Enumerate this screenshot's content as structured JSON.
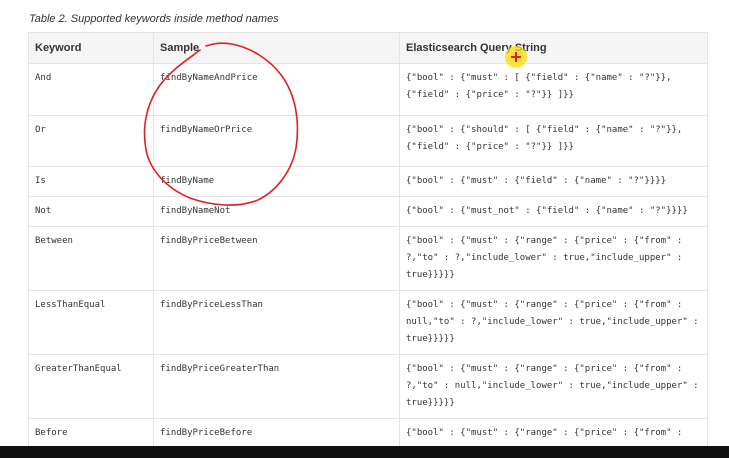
{
  "caption": "Table 2. Supported keywords inside method names",
  "table": {
    "headers": [
      "Keyword",
      "Sample",
      "Elasticsearch Query String"
    ],
    "rows": [
      {
        "keyword": "And",
        "sample": "findByNameAndPrice",
        "query": "{\"bool\" : {\"must\" : [ {\"field\" : {\"name\" : \"?\"}}, {\"field\" : {\"price\" : \"?\"}} ]}}"
      },
      {
        "keyword": "Or",
        "sample": "findByNameOrPrice",
        "query": "{\"bool\" : {\"should\" : [ {\"field\" : {\"name\" : \"?\"}}, {\"field\" : {\"price\" : \"?\"}} ]}}"
      },
      {
        "keyword": "Is",
        "sample": "findByName",
        "query": "{\"bool\" : {\"must\" : {\"field\" : {\"name\" : \"?\"}}}}"
      },
      {
        "keyword": "Not",
        "sample": "findByNameNot",
        "query": "{\"bool\" : {\"must_not\" : {\"field\" : {\"name\" : \"?\"}}}}"
      },
      {
        "keyword": "Between",
        "sample": "findByPriceBetween",
        "query": "{\"bool\" : {\"must\" : {\"range\" : {\"price\" : {\"from\" : ?,\"to\" : ?,\"include_lower\" : true,\"include_upper\" : true}}}}}"
      },
      {
        "keyword": "LessThanEqual",
        "sample": "findByPriceLessThan",
        "query": "{\"bool\" : {\"must\" : {\"range\" : {\"price\" : {\"from\" : null,\"to\" : ?,\"include_lower\" : true,\"include_upper\" : true}}}}}"
      },
      {
        "keyword": "GreaterThanEqual",
        "sample": "findByPriceGreaterThan",
        "query": "{\"bool\" : {\"must\" : {\"range\" : {\"price\" : {\"from\" : ?,\"to\" : null,\"include_lower\" : true,\"include_upper\" : true}}}}}"
      },
      {
        "keyword": "Before",
        "sample": "findByPriceBefore",
        "query": "{\"bool\" : {\"must\" : {\"range\" : {\"price\" : {\"from\" :"
      }
    ]
  },
  "colors": {
    "annotation": "#e02020",
    "cursor_highlight": "#ffdc00"
  }
}
